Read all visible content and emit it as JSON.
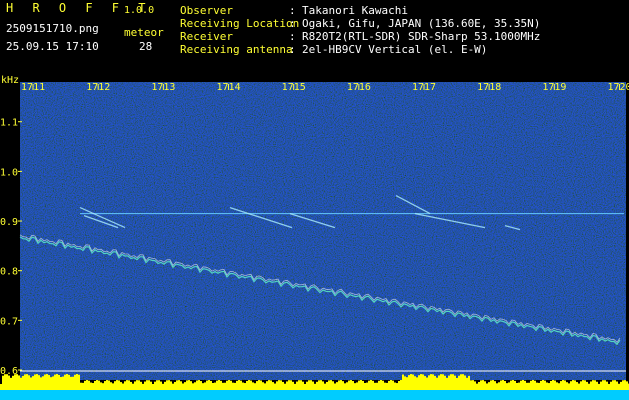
{
  "header": {
    "app_title": "H R O F F T",
    "app_version": "1.0.0",
    "filename": "2509151710.png",
    "datetime": "25.09.15 17:10",
    "count_label": "meteor",
    "count_value": "28",
    "info": [
      {
        "key": "Observer",
        "value": "Takanori Kawachi"
      },
      {
        "key": "Receiving Location",
        "value": "Ogaki, Gifu, JAPAN (136.60E, 35.35N)"
      },
      {
        "key": "Receiver",
        "value": "R820T2(RTL-SDR) SDR-Sharp 53.1000MHz"
      },
      {
        "key": "Receiving antenna",
        "value": "2el-HB9CV Vertical (el. E-W)"
      }
    ],
    "separator": ":"
  },
  "colors": {
    "background": "#000000",
    "header_yellow": "#ffff33",
    "header_green": "#33ff66",
    "noise_blue": "#0a1ea0",
    "carrier_cyan": "#66ccff",
    "level_yellow": "#ffff00",
    "level_cyan": "#00ccff"
  },
  "spectrogram": {
    "y_unit": "kHz",
    "y_ticks": [
      "1.1",
      "1.0",
      "0.9",
      "0.8",
      "0.7",
      "0.6"
    ],
    "y_tick_values": [
      1.1,
      1.0,
      0.9,
      0.8,
      0.7,
      0.6
    ],
    "y_range": [
      0.6,
      1.18
    ],
    "x_ticks": [
      "1711",
      "1712",
      "1713",
      "1714",
      "1715",
      "1716",
      "1717",
      "1718",
      "1719",
      "1720"
    ],
    "x_range_minutes": [
      1710.8,
      1720.1
    ],
    "carrier_khz": 0.915
  }
}
